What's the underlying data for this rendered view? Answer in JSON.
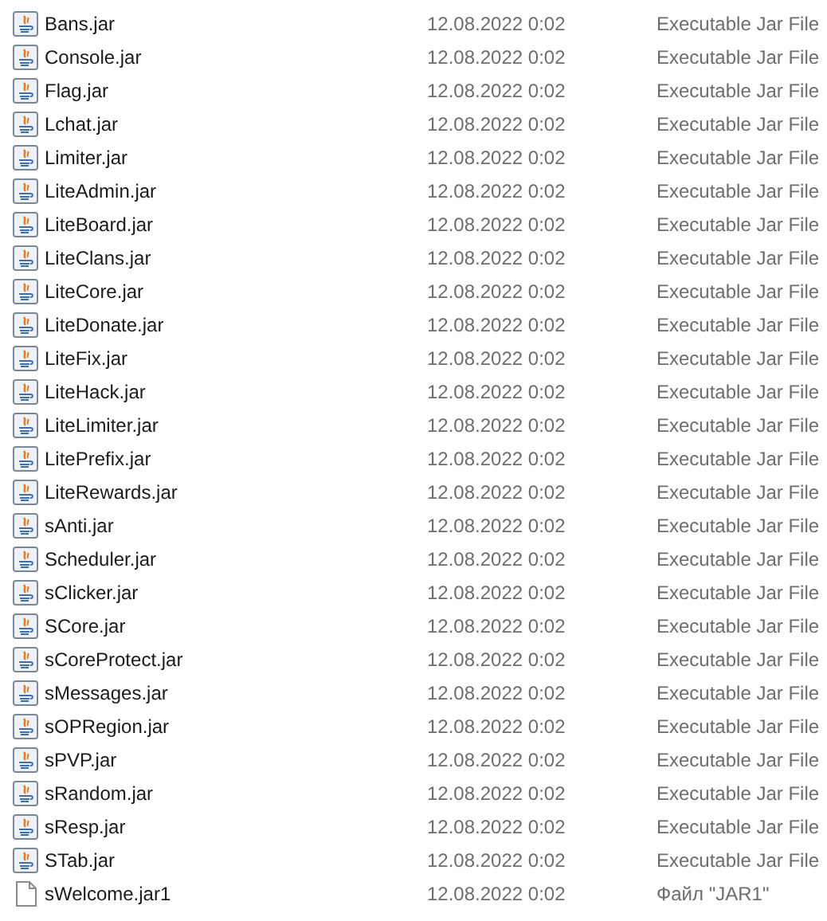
{
  "files": [
    {
      "name": "Bans.jar",
      "kind": "jar",
      "date": "12.08.2022 0:02",
      "type": "Executable Jar File"
    },
    {
      "name": "Console.jar",
      "kind": "jar",
      "date": "12.08.2022 0:02",
      "type": "Executable Jar File"
    },
    {
      "name": "Flag.jar",
      "kind": "jar",
      "date": "12.08.2022 0:02",
      "type": "Executable Jar File"
    },
    {
      "name": "Lchat.jar",
      "kind": "jar",
      "date": "12.08.2022 0:02",
      "type": "Executable Jar File"
    },
    {
      "name": "Limiter.jar",
      "kind": "jar",
      "date": "12.08.2022 0:02",
      "type": "Executable Jar File"
    },
    {
      "name": "LiteAdmin.jar",
      "kind": "jar",
      "date": "12.08.2022 0:02",
      "type": "Executable Jar File"
    },
    {
      "name": "LiteBoard.jar",
      "kind": "jar",
      "date": "12.08.2022 0:02",
      "type": "Executable Jar File"
    },
    {
      "name": "LiteClans.jar",
      "kind": "jar",
      "date": "12.08.2022 0:02",
      "type": "Executable Jar File"
    },
    {
      "name": "LiteCore.jar",
      "kind": "jar",
      "date": "12.08.2022 0:02",
      "type": "Executable Jar File"
    },
    {
      "name": "LiteDonate.jar",
      "kind": "jar",
      "date": "12.08.2022 0:02",
      "type": "Executable Jar File"
    },
    {
      "name": "LiteFix.jar",
      "kind": "jar",
      "date": "12.08.2022 0:02",
      "type": "Executable Jar File"
    },
    {
      "name": "LiteHack.jar",
      "kind": "jar",
      "date": "12.08.2022 0:02",
      "type": "Executable Jar File"
    },
    {
      "name": "LiteLimiter.jar",
      "kind": "jar",
      "date": "12.08.2022 0:02",
      "type": "Executable Jar File"
    },
    {
      "name": "LitePrefix.jar",
      "kind": "jar",
      "date": "12.08.2022 0:02",
      "type": "Executable Jar File"
    },
    {
      "name": "LiteRewards.jar",
      "kind": "jar",
      "date": "12.08.2022 0:02",
      "type": "Executable Jar File"
    },
    {
      "name": "sAnti.jar",
      "kind": "jar",
      "date": "12.08.2022 0:02",
      "type": "Executable Jar File"
    },
    {
      "name": "Scheduler.jar",
      "kind": "jar",
      "date": "12.08.2022 0:02",
      "type": "Executable Jar File"
    },
    {
      "name": "sClicker.jar",
      "kind": "jar",
      "date": "12.08.2022 0:02",
      "type": "Executable Jar File"
    },
    {
      "name": "SCore.jar",
      "kind": "jar",
      "date": "12.08.2022 0:02",
      "type": "Executable Jar File"
    },
    {
      "name": "sCoreProtect.jar",
      "kind": "jar",
      "date": "12.08.2022 0:02",
      "type": "Executable Jar File"
    },
    {
      "name": "sMessages.jar",
      "kind": "jar",
      "date": "12.08.2022 0:02",
      "type": "Executable Jar File"
    },
    {
      "name": "sOPRegion.jar",
      "kind": "jar",
      "date": "12.08.2022 0:02",
      "type": "Executable Jar File"
    },
    {
      "name": "sPVP.jar",
      "kind": "jar",
      "date": "12.08.2022 0:02",
      "type": "Executable Jar File"
    },
    {
      "name": "sRandom.jar",
      "kind": "jar",
      "date": "12.08.2022 0:02",
      "type": "Executable Jar File"
    },
    {
      "name": "sResp.jar",
      "kind": "jar",
      "date": "12.08.2022 0:02",
      "type": "Executable Jar File"
    },
    {
      "name": "STab.jar",
      "kind": "jar",
      "date": "12.08.2022 0:02",
      "type": "Executable Jar File"
    },
    {
      "name": "sWelcome.jar1",
      "kind": "file",
      "date": "12.08.2022 0:02",
      "type": "Файл \"JAR1\""
    }
  ]
}
